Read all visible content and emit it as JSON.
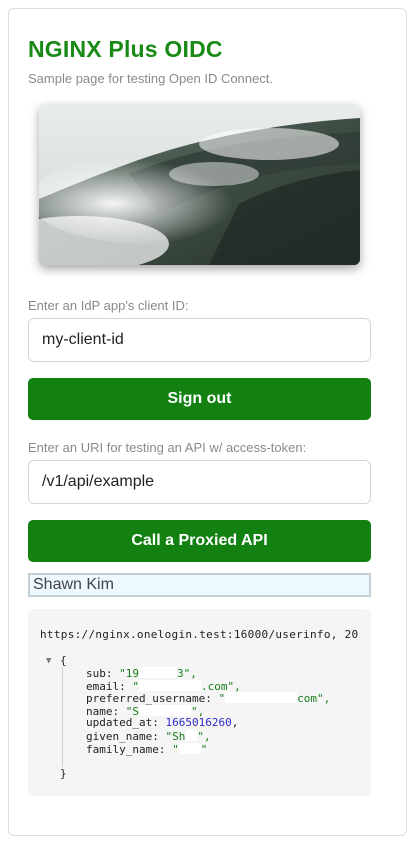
{
  "header": {
    "title": "NGINX Plus OIDC",
    "subtitle": "Sample page for testing Open ID Connect."
  },
  "client_id": {
    "label": "Enter an IdP app's client ID:",
    "value": "my-client-id"
  },
  "sign_out_button": "Sign out",
  "api_uri": {
    "label": "Enter an URI for testing an API w/ access-token:",
    "value": "/v1/api/example"
  },
  "call_api_button": "Call a Proxied API",
  "user": {
    "name": "Shawn Kim"
  },
  "response": {
    "request_url": "https://nginx.onelogin.test:16000/userinfo, 20",
    "toggle": "▼",
    "open_brace": "{",
    "close_brace": "}",
    "fields": [
      {
        "key": "sub",
        "open": "\"19",
        "tail": "3\","
      },
      {
        "key": "email",
        "open": "\"",
        "tail": ".com\","
      },
      {
        "key": "preferred_username",
        "open": "\"",
        "tail": "com\","
      },
      {
        "key": "name",
        "open": "\"S",
        "tail": "\","
      },
      {
        "key": "updated_at",
        "number": "1665016260",
        "tail": ","
      },
      {
        "key": "given_name",
        "open": "\"Sh",
        "tail": "\","
      },
      {
        "key": "family_name",
        "open": "\"",
        "tail": "\""
      }
    ]
  },
  "colors": {
    "brand_green": "#1a8a16",
    "button_green": "#128112",
    "string_green": "#1a7f1a",
    "number_blue": "#2b2bc4"
  }
}
